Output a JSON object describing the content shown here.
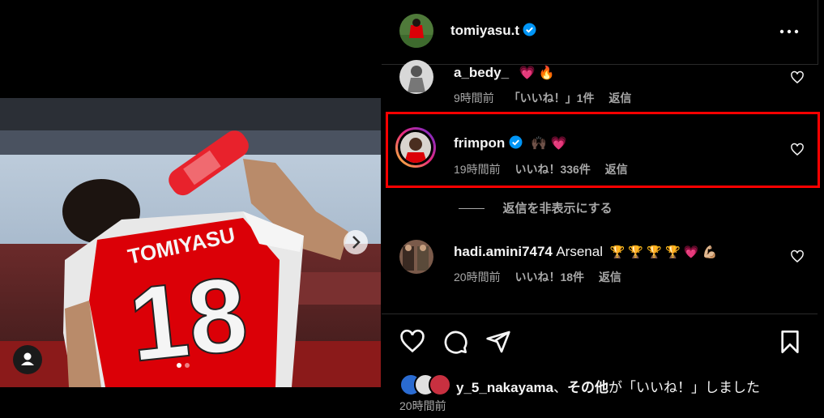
{
  "post": {
    "author": "tomiyasu.t",
    "more_icon": "more-horizontal-icon",
    "shirt_name": "TOMIYASU",
    "shirt_number": "18",
    "carousel_next_icon": "chevron-right-icon",
    "tagged_user_icon": "user-icon"
  },
  "comments": [
    {
      "username": "a_bedy_",
      "emoji": "💗 🔥",
      "time": "9時間前",
      "likes": "「いいね！」1件",
      "reply": "返信"
    },
    {
      "username": "frimpon",
      "verified": true,
      "emoji": "🙌🏿 💗",
      "time": "19時間前",
      "likes": "いいね！336件",
      "reply": "返信",
      "highlighted": true,
      "highlight_color": "#ff0000"
    },
    {
      "username": "hadi.amini7474",
      "text": "Arsenal",
      "emoji": "🏆 🏆 🏆 🏆 💗 💪🏼",
      "time": "20時間前",
      "likes": "いいね！18件",
      "reply": "返信"
    }
  ],
  "hide_replies": "返信を非表示にする",
  "liked_by": {
    "user": "y_5_nakayama",
    "separator": "、",
    "others": "その他",
    "suffix": "が「いいね！」しました"
  },
  "post_time": "20時間前",
  "colors": {
    "background": "#000000",
    "verified": "#0095f6",
    "secondary_text": "#a8a8a8",
    "arsenal_red": "#db0007"
  }
}
